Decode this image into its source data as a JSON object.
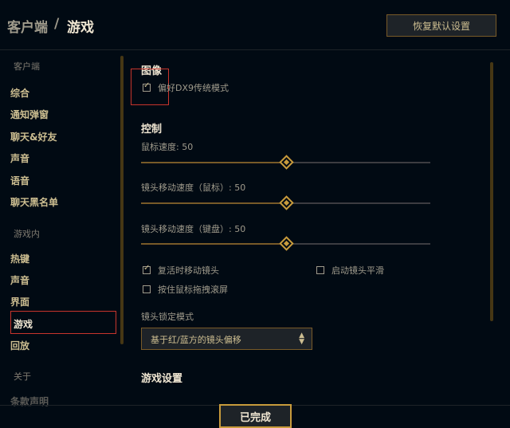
{
  "header": {
    "breadcrumb_parent": "客户端",
    "breadcrumb_separator": "/",
    "breadcrumb_current": "游戏",
    "restore_defaults_label": "恢复默认设置"
  },
  "sidebar": {
    "client_section": "客户端",
    "client_items": [
      "综合",
      "通知弹窗",
      "聊天&好友",
      "声音",
      "语音",
      "聊天黑名单"
    ],
    "ingame_section": "游戏内",
    "ingame_items": [
      "热键",
      "声音",
      "界面",
      "游戏",
      "回放"
    ],
    "about_section": "关于",
    "about_items": [
      "条款声明"
    ],
    "active_item": "游戏"
  },
  "main": {
    "graphics_heading": "图像",
    "dx9_label": "偏好DX9传统模式",
    "dx9_checked": true,
    "control_heading": "控制",
    "mouse_speed_label": "鼠标速度: 50",
    "mouse_speed_value": 50,
    "camera_mouse_label": "镜头移动速度（鼠标）: 50",
    "camera_mouse_value": 50,
    "camera_keyboard_label": "镜头移动速度（键盘）: 50",
    "camera_keyboard_value": 50,
    "respawn_move_camera_label": "复活时移动镜头",
    "respawn_move_camera_checked": true,
    "camera_smoothing_label": "启动镜头平滑",
    "camera_smoothing_checked": false,
    "drag_scroll_label": "按住鼠标拖拽滚屏",
    "drag_scroll_checked": false,
    "camera_lock_label": "镜头锁定模式",
    "camera_lock_value": "基于红/蓝方的镜头偏移",
    "game_settings_heading": "游戏设置"
  },
  "footer": {
    "done_label": "已完成"
  },
  "colors": {
    "background": "#010a13",
    "gold": "#c89b3c",
    "gold_dark": "#785a28",
    "highlight_red": "#c8352c"
  }
}
